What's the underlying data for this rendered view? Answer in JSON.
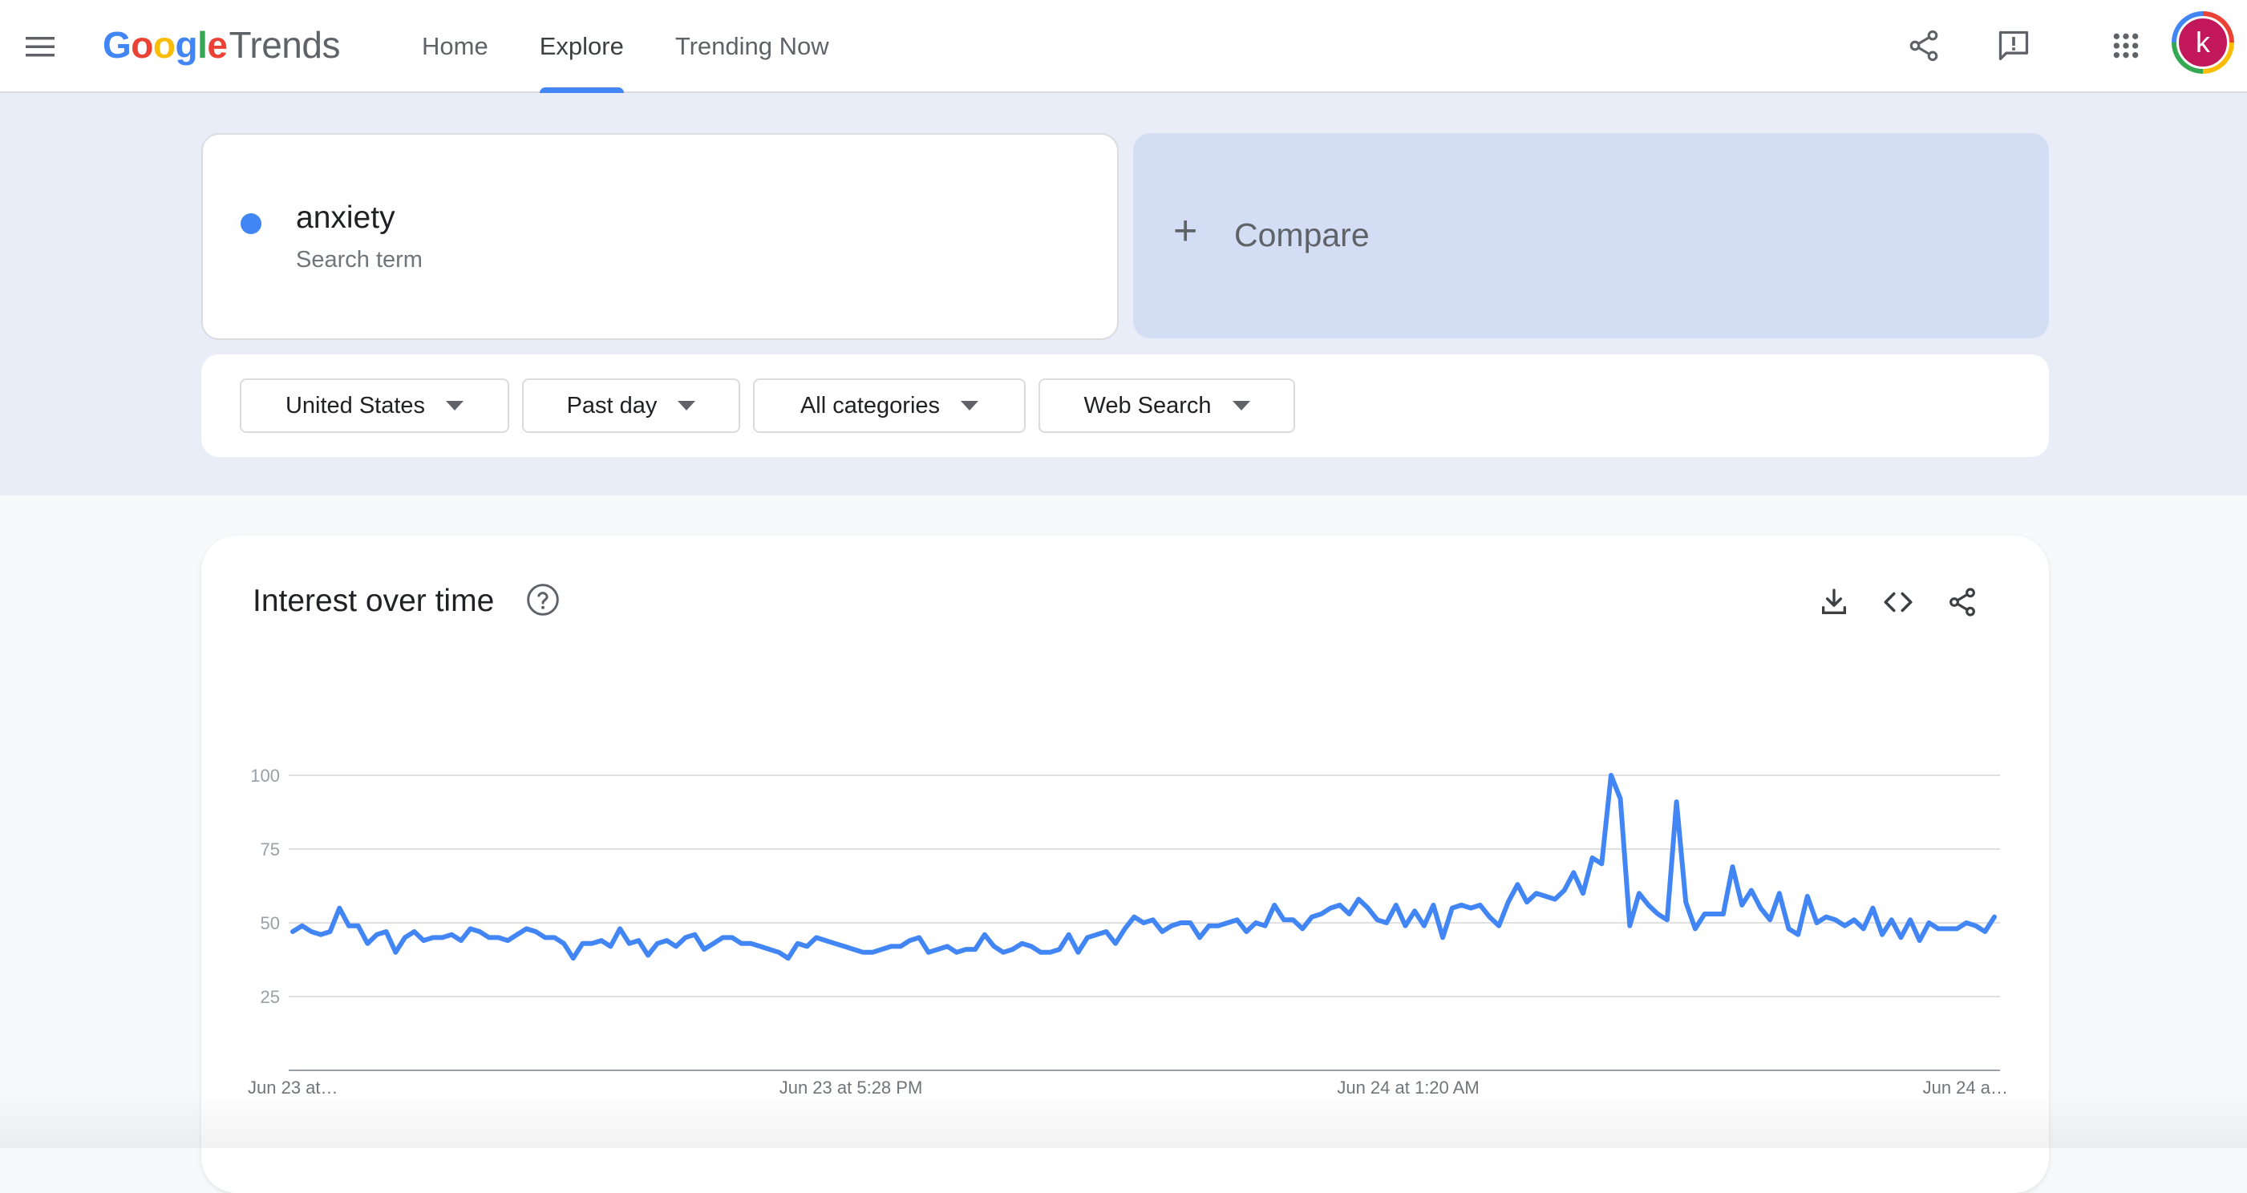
{
  "header": {
    "logo": {
      "google": [
        "G",
        "o",
        "o",
        "g",
        "l",
        "e"
      ],
      "product": "Trends"
    },
    "nav": [
      {
        "label": "Home",
        "active": false
      },
      {
        "label": "Explore",
        "active": true
      },
      {
        "label": "Trending Now",
        "active": false
      }
    ],
    "icons": [
      "menu-icon",
      "share-icon",
      "feedback-icon",
      "apps-icon"
    ],
    "avatar_letter": "k"
  },
  "search": {
    "term": "anxiety",
    "term_type": "Search term",
    "term_color": "#4285f4",
    "compare_label": "Compare"
  },
  "filters": [
    {
      "label": "United States"
    },
    {
      "label": "Past day"
    },
    {
      "label": "All categories"
    },
    {
      "label": "Web Search"
    }
  ],
  "interest_card": {
    "title": "Interest over time",
    "icons": [
      "help-icon",
      "download-icon",
      "embed-icon",
      "share-icon"
    ]
  },
  "chart_data": {
    "type": "line",
    "title": "Interest over time",
    "xlabel": "",
    "ylabel": "",
    "ylim": [
      0,
      100
    ],
    "yticks": [
      25,
      50,
      75,
      100
    ],
    "x_tick_labels": [
      "Jun 23 at…",
      "Jun 23 at 5:28 PM",
      "Jun 24 at 1:20 AM",
      "Jun 24 a…"
    ],
    "grid": true,
    "color": "#4285f4",
    "series": [
      {
        "values": [
          47,
          49,
          47,
          46,
          47,
          55,
          49,
          49,
          43,
          46,
          47,
          40,
          45,
          47,
          44,
          45,
          45,
          46,
          44,
          48,
          47,
          45,
          45,
          44,
          46,
          48,
          47,
          45,
          45,
          43,
          38,
          43,
          43,
          44,
          42,
          48,
          43,
          44,
          39,
          43,
          44,
          42,
          45,
          46,
          41,
          43,
          45,
          45,
          43,
          43,
          42,
          41,
          40,
          38,
          43,
          42,
          45,
          44,
          43,
          42,
          41,
          40,
          40,
          41,
          42,
          42,
          44,
          45,
          40,
          41,
          42,
          40,
          41,
          41,
          46,
          42,
          40,
          41,
          43,
          42,
          40,
          40,
          41,
          46,
          40,
          45,
          46,
          47,
          43,
          48,
          52,
          50,
          51,
          47,
          49,
          50,
          50,
          45,
          49,
          49,
          50,
          51,
          47,
          50,
          49,
          56,
          51,
          51,
          48,
          52,
          53,
          55,
          56,
          53,
          58,
          55,
          51,
          50,
          56,
          49,
          54,
          49,
          56,
          45,
          55,
          56,
          55,
          56,
          52,
          49,
          57,
          63,
          57,
          60,
          59,
          58,
          61,
          67,
          60,
          72,
          70,
          100,
          92,
          49,
          60,
          56,
          53,
          51,
          91,
          57,
          48,
          53,
          53,
          53,
          69,
          56,
          61,
          55,
          51,
          60,
          48,
          46,
          59,
          50,
          52,
          51,
          49,
          51,
          48,
          55,
          46,
          51,
          45,
          51,
          44,
          50,
          48,
          48,
          48,
          50,
          49,
          47,
          52
        ]
      }
    ]
  }
}
